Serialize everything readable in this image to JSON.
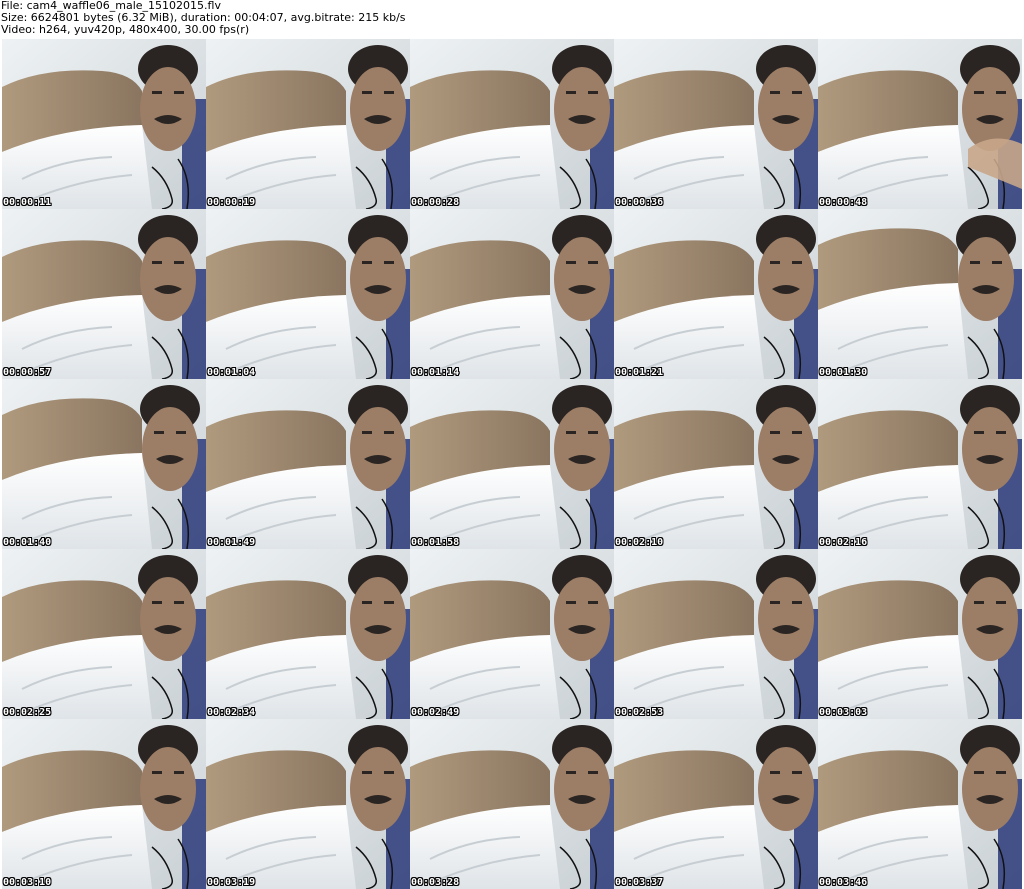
{
  "header": {
    "file_line": "File: cam4_waffle06_male_15102015.flv",
    "size_line": "Size: 6624801 bytes (6.32 MiB), duration: 00:04:07, avg.bitrate: 215 kb/s",
    "video_line": "Video: h264, yuv420p, 480x400, 30.00 fps(r)"
  },
  "thumbnails": [
    {
      "timestamp": "00:00:11",
      "variant": "a"
    },
    {
      "timestamp": "00:00:19",
      "variant": "b"
    },
    {
      "timestamp": "00:00:28",
      "variant": "b"
    },
    {
      "timestamp": "00:00:36",
      "variant": "b"
    },
    {
      "timestamp": "00:00:48",
      "variant": "c"
    },
    {
      "timestamp": "00:00:57",
      "variant": "a"
    },
    {
      "timestamp": "00:01:04",
      "variant": "b"
    },
    {
      "timestamp": "00:01:14",
      "variant": "b"
    },
    {
      "timestamp": "00:01:21",
      "variant": "b"
    },
    {
      "timestamp": "00:01:30",
      "variant": "d"
    },
    {
      "timestamp": "00:01:40",
      "variant": "d"
    },
    {
      "timestamp": "00:01:49",
      "variant": "b"
    },
    {
      "timestamp": "00:01:58",
      "variant": "b"
    },
    {
      "timestamp": "00:02:10",
      "variant": "b"
    },
    {
      "timestamp": "00:02:16",
      "variant": "b"
    },
    {
      "timestamp": "00:02:25",
      "variant": "a"
    },
    {
      "timestamp": "00:02:34",
      "variant": "b"
    },
    {
      "timestamp": "00:02:49",
      "variant": "b"
    },
    {
      "timestamp": "00:02:53",
      "variant": "b"
    },
    {
      "timestamp": "00:03:03",
      "variant": "b"
    },
    {
      "timestamp": "00:03:10",
      "variant": "a"
    },
    {
      "timestamp": "00:03:19",
      "variant": "b"
    },
    {
      "timestamp": "00:03:28",
      "variant": "b"
    },
    {
      "timestamp": "00:03:37",
      "variant": "b"
    },
    {
      "timestamp": "00:03:46",
      "variant": "b"
    }
  ],
  "colors": {
    "background": "#ffffff",
    "header_text": "#000000",
    "timestamp_text": "#ffffff",
    "timestamp_outline": "#000000"
  }
}
